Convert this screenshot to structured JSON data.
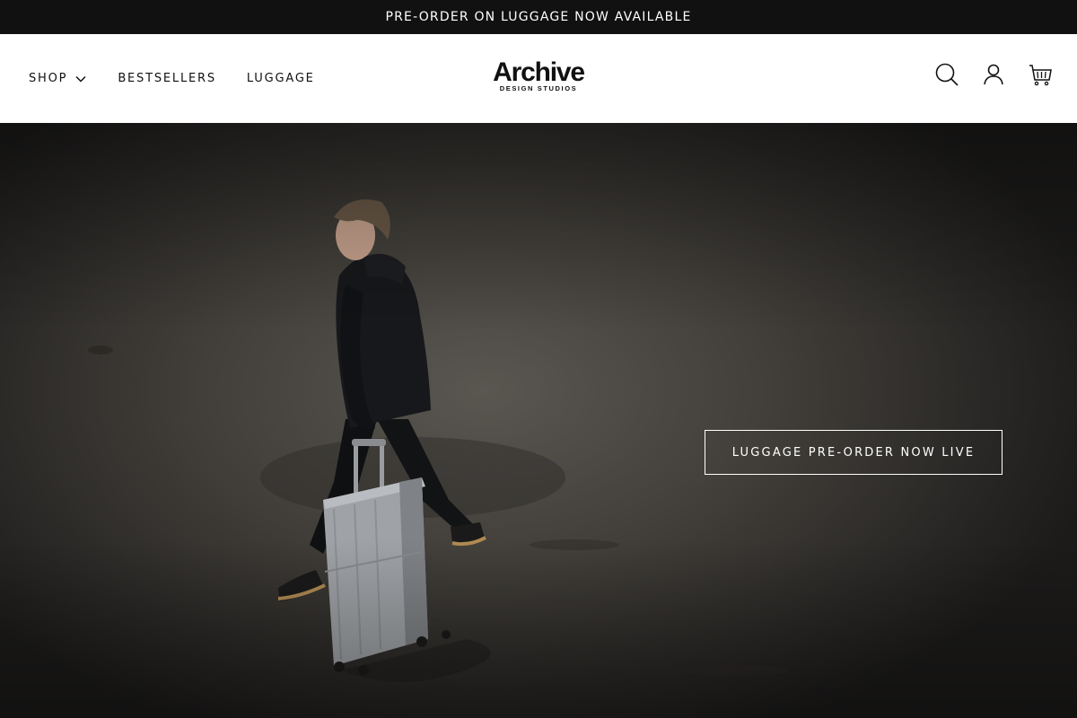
{
  "announcement": {
    "text": "PRE-ORDER ON LUGGAGE NOW AVAILABLE"
  },
  "nav": {
    "items": [
      {
        "label": "SHOP",
        "has_dropdown": true
      },
      {
        "label": "BESTSELLERS"
      },
      {
        "label": "LUGGAGE"
      }
    ]
  },
  "logo": {
    "main": "Archive",
    "sub": "DESIGN STUDIOS"
  },
  "header_icons": [
    "search-icon",
    "account-icon",
    "cart-icon"
  ],
  "hero": {
    "cta_label": "LUGGAGE PRE-ORDER NOW LIVE",
    "image_subject": "person walking with silver suitcase on concrete floor"
  },
  "colors": {
    "announcement_bg": "#111111",
    "header_bg": "#ffffff",
    "text_dark": "#111111",
    "cta_border": "#ffffff"
  }
}
